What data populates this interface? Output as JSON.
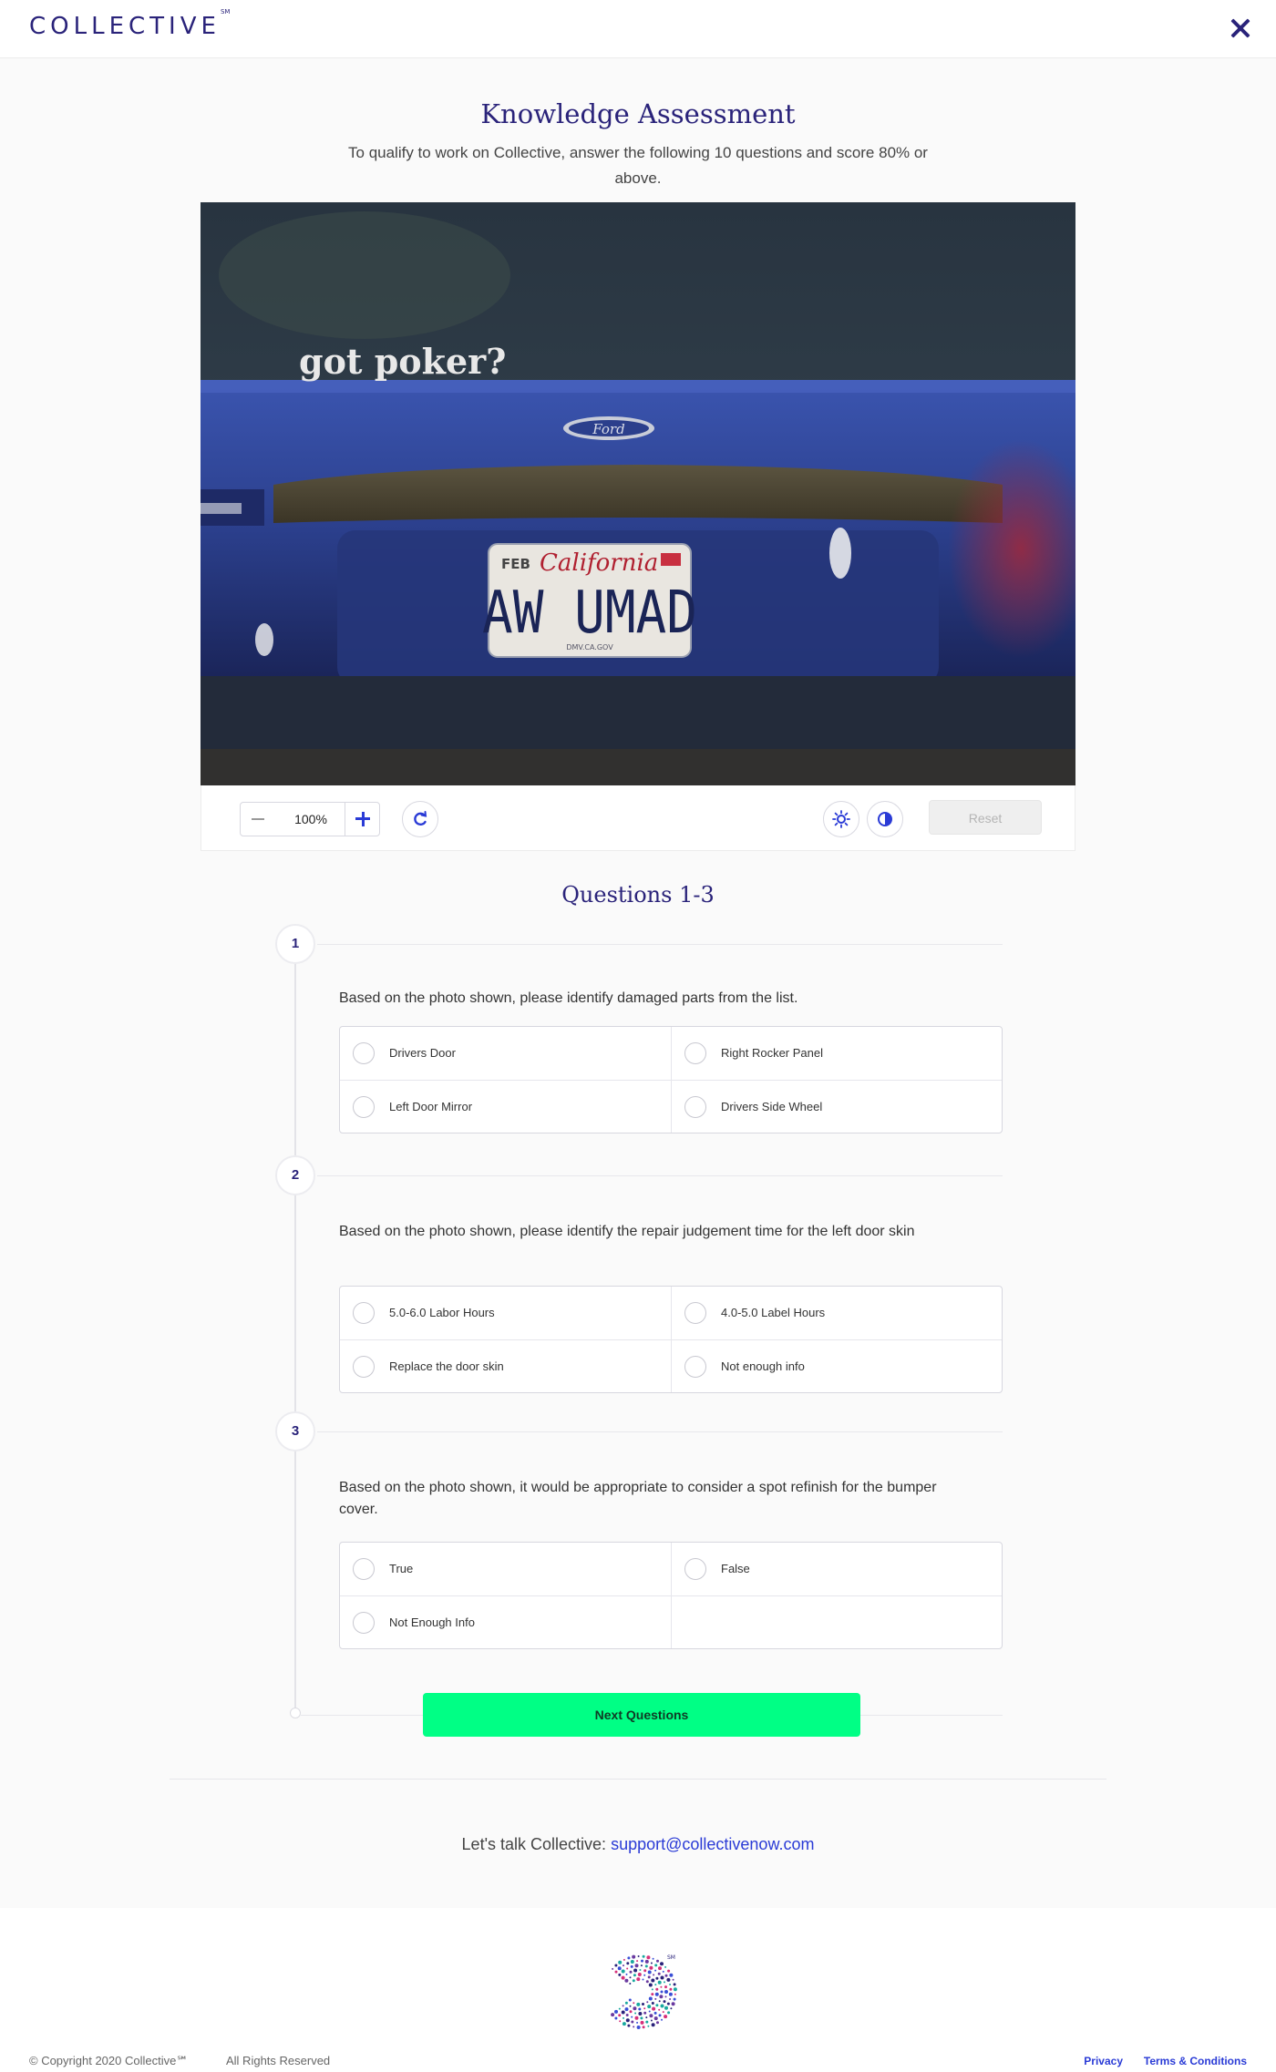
{
  "header": {
    "logo_text": "COLLECTIVE",
    "logo_mark": "SM",
    "close_icon": "close-icon"
  },
  "page": {
    "title": "Knowledge Assessment",
    "intro": "To qualify to work on Collective, answer the following 10 questions and score 80% or above."
  },
  "photo": {
    "sticker_text": "got poker?",
    "badge_text": "Ford",
    "plate_month": "FEB",
    "plate_state": "California",
    "plate_number": "AW UMAD",
    "plate_footer": "DMV.CA.GOV"
  },
  "toolbar": {
    "zoom_value": "100%",
    "zoom_out_icon": "minus-icon",
    "zoom_in_icon": "plus-icon",
    "rotate_icon": "rotate-icon",
    "brightness_icon": "sun-icon",
    "contrast_icon": "contrast-icon",
    "reset_label": "Reset"
  },
  "questions_heading": "Questions 1-3",
  "questions": [
    {
      "number": "1",
      "text": "Based on the photo shown, please identify damaged parts from the list.",
      "options": [
        "Drivers Door",
        "Right Rocker Panel",
        "Left Door Mirror",
        "Drivers Side Wheel"
      ]
    },
    {
      "number": "2",
      "text": "Based on the photo shown, please identify the repair judgement time for the left door skin",
      "options": [
        "5.0-6.0 Labor Hours",
        "4.0-5.0 Label Hours",
        "Replace the door skin",
        "Not enough info"
      ]
    },
    {
      "number": "3",
      "text": "Based on the photo shown, it would be appropriate to consider a spot refinish for the bumper cover.",
      "options": [
        "True",
        "False",
        "Not Enough Info"
      ]
    }
  ],
  "next_button": "Next Questions",
  "contact": {
    "prefix": "Let's talk Collective:",
    "email": "support@collectivenow.com"
  },
  "footer": {
    "logo_mark": "SM",
    "copyright": "© Copyright 2020 Collective℠",
    "rights": "All Rights Reserved",
    "privacy": "Privacy",
    "terms": "Terms & Conditions"
  },
  "colors": {
    "brand": "#2a237a",
    "link": "#2a3bd6",
    "cta": "#00ff85"
  }
}
